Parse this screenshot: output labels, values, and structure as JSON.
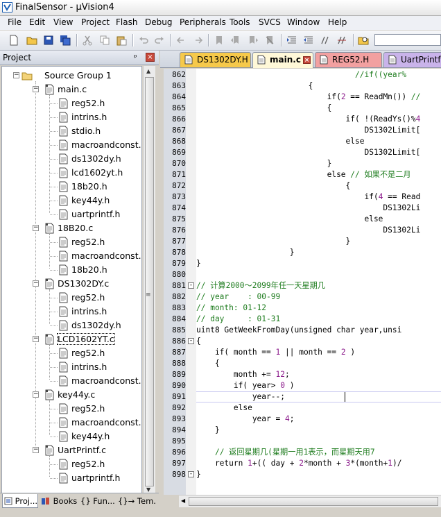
{
  "window": {
    "title": "FinalSensor  - µVision4"
  },
  "menu": [
    "File",
    "Edit",
    "View",
    "Project",
    "Flash",
    "Debug",
    "Peripherals",
    "Tools",
    "SVCS",
    "Window",
    "Help"
  ],
  "project_panel": {
    "title": "Project",
    "pin_glyph": "ᵖ",
    "close_glyph": "×",
    "tabs": [
      "Proj...",
      "Books",
      "{} Fun...",
      "{}→ Tem..."
    ]
  },
  "tree": {
    "group": "Source Group 1",
    "files": [
      {
        "name": "main.c",
        "children": [
          "reg52.h",
          "intrins.h",
          "stdio.h",
          "macroandconst.h",
          "ds1302dy.h",
          "lcd1602yt.h",
          "18b20.h",
          "key44y.h",
          "uartprintf.h"
        ]
      },
      {
        "name": "18B20.c",
        "children": [
          "reg52.h",
          "macroandconst.h",
          "18b20.h"
        ]
      },
      {
        "name": "DS1302DY.c",
        "children": [
          "reg52.h",
          "intrins.h",
          "ds1302dy.h"
        ]
      },
      {
        "name": "LCD1602YT.c",
        "children": [
          "reg52.h",
          "intrins.h",
          "macroandconst.h"
        ]
      },
      {
        "name": "key44y.c",
        "children": [
          "reg52.h",
          "macroandconst.h",
          "key44y.h"
        ]
      },
      {
        "name": "UartPrintf.c",
        "children": [
          "reg52.h",
          "uartprintf.h"
        ]
      }
    ]
  },
  "editor": {
    "tabs": [
      {
        "label": "DS1302DY.H",
        "color": "#f6c94a",
        "active": false
      },
      {
        "label": "main.c",
        "color": "#ffe98a",
        "active": true
      },
      {
        "label": "REG52.H",
        "color": "#f2a0a0",
        "active": false
      },
      {
        "label": "UartPrintf.c",
        "color": "#c9b3ea",
        "active": false
      }
    ],
    "current_line": 891,
    "lines": [
      {
        "n": 862,
        "text": "                                  //if((year%",
        "fold": ""
      },
      {
        "n": 863,
        "text": "                        {",
        "fold": ""
      },
      {
        "n": 864,
        "text": "                            if(2 == ReadMn()) //",
        "fold": ""
      },
      {
        "n": 865,
        "text": "                            {",
        "fold": ""
      },
      {
        "n": 866,
        "text": "                                if( !(ReadYs()%4",
        "fold": ""
      },
      {
        "n": 867,
        "text": "                                    DS1302Limit[",
        "fold": ""
      },
      {
        "n": 868,
        "text": "                                else",
        "fold": ""
      },
      {
        "n": 869,
        "text": "                                    DS1302Limit[",
        "fold": ""
      },
      {
        "n": 870,
        "text": "                            }",
        "fold": ""
      },
      {
        "n": 871,
        "text": "                            else // 如果不是二月",
        "fold": ""
      },
      {
        "n": 872,
        "text": "                                {",
        "fold": ""
      },
      {
        "n": 873,
        "text": "                                    if(4 == Read",
        "fold": ""
      },
      {
        "n": 874,
        "text": "                                        DS1302Li",
        "fold": ""
      },
      {
        "n": 875,
        "text": "                                    else",
        "fold": ""
      },
      {
        "n": 876,
        "text": "                                        DS1302Li",
        "fold": ""
      },
      {
        "n": 877,
        "text": "                                }",
        "fold": ""
      },
      {
        "n": 878,
        "text": "                    }",
        "fold": ""
      },
      {
        "n": 879,
        "text": "}",
        "fold": ""
      },
      {
        "n": 880,
        "text": "",
        "fold": ""
      },
      {
        "n": 881,
        "text": "// 计算2000～2099年任一天星期几",
        "fold": "-"
      },
      {
        "n": 882,
        "text": "// year    : 00-99",
        "fold": ""
      },
      {
        "n": 883,
        "text": "// month: 01-12",
        "fold": ""
      },
      {
        "n": 884,
        "text": "// day     : 01-31",
        "fold": ""
      },
      {
        "n": 885,
        "text": "uint8 GetWeekFromDay(unsigned char year,unsi",
        "fold": ""
      },
      {
        "n": 886,
        "text": "{",
        "fold": "-"
      },
      {
        "n": 887,
        "text": "    if( month == 1 || month == 2 )",
        "fold": ""
      },
      {
        "n": 888,
        "text": "    {",
        "fold": ""
      },
      {
        "n": 889,
        "text": "        month += 12;",
        "fold": ""
      },
      {
        "n": 890,
        "text": "        if( year> 0 )",
        "fold": ""
      },
      {
        "n": 891,
        "text": "            year--;",
        "fold": ""
      },
      {
        "n": 892,
        "text": "        else",
        "fold": ""
      },
      {
        "n": 893,
        "text": "            year = 4;",
        "fold": ""
      },
      {
        "n": 894,
        "text": "    }",
        "fold": ""
      },
      {
        "n": 895,
        "text": "",
        "fold": ""
      },
      {
        "n": 896,
        "text": "    // 返回星期几(星期一用1表示，而星期天用7",
        "fold": ""
      },
      {
        "n": 897,
        "text": "    return 1+(( day + 2*month + 3*(month+1)/",
        "fold": ""
      },
      {
        "n": 898,
        "text": "}",
        "fold": "-"
      }
    ]
  },
  "colors": {
    "comment": "#1e7c1e",
    "number": "#8b1a8b",
    "keyword": "#00008b"
  }
}
